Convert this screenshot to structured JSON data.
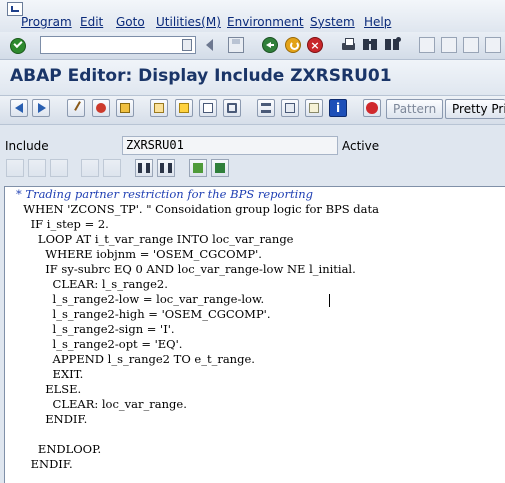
{
  "menubar": {
    "items": [
      {
        "label": "Program"
      },
      {
        "label": "Edit"
      },
      {
        "label": "Goto"
      },
      {
        "label": "Utilities(M)"
      },
      {
        "label": "Environment"
      },
      {
        "label": "System"
      },
      {
        "label": "Help"
      }
    ]
  },
  "system_toolbar": {
    "command_field": {
      "value": ""
    }
  },
  "title": "ABAP Editor: Display Include ZXRSRU01",
  "app_toolbar": {
    "pattern_label": "Pattern",
    "pretty_printer_label": "Pretty Prin"
  },
  "include": {
    "label": "Include",
    "value": "ZXRSRU01",
    "status": "Active"
  },
  "editor": {
    "lines": [
      "* Trading partner restriction for the BPS reporting",
      "  WHEN 'ZCONS_TP'. \" Consoidation group logic for BPS data",
      "    IF i_step = 2.",
      "      LOOP AT i_t_var_range INTO loc_var_range",
      "        WHERE iobjnm = 'OSEM_CGCOMP'.",
      "        IF sy-subrc EQ 0 AND loc_var_range-low NE l_initial.",
      "          CLEAR: l_s_range2.",
      "          l_s_range2-low = loc_var_range-low.",
      "          l_s_range2-high = 'OSEM_CGCOMP'.",
      "          l_s_range2-sign = 'I'.",
      "          l_s_range2-opt = 'EQ'.",
      "          APPEND l_s_range2 TO e_t_range.",
      "          EXIT.",
      "        ELSE.",
      "          CLEAR: loc_var_range.",
      "        ENDIF.",
      "",
      "      ENDLOOP.",
      "    ENDIF."
    ]
  }
}
